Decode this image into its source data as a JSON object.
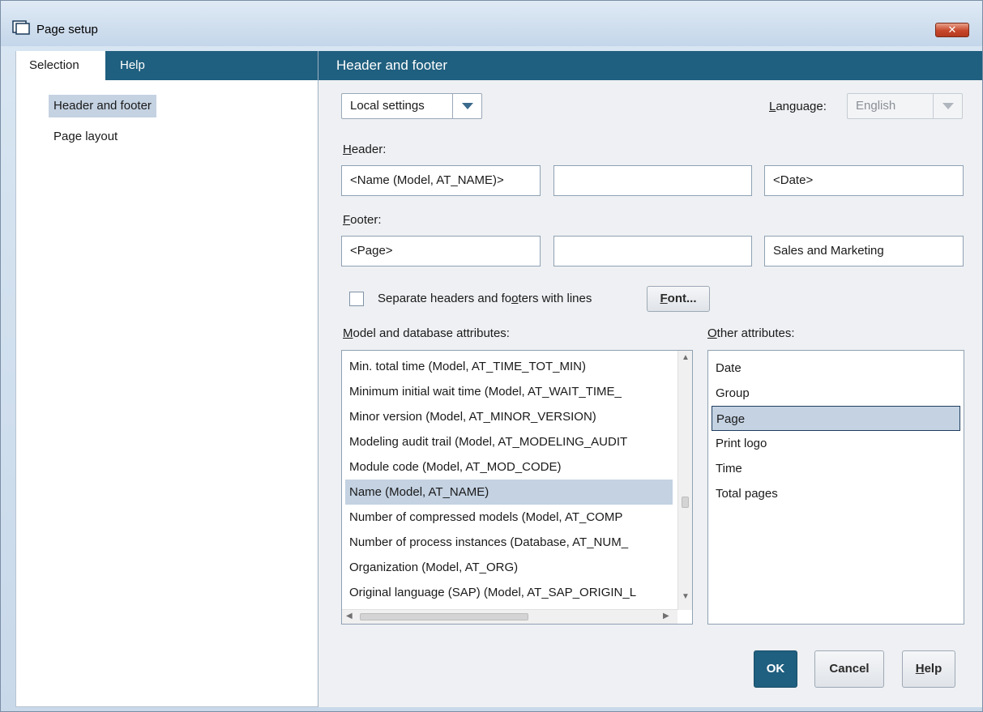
{
  "window": {
    "title": "Page setup",
    "close_label": "✕"
  },
  "left": {
    "tabs": [
      {
        "label": "Selection",
        "active": true
      },
      {
        "label": "Help",
        "active": false
      }
    ],
    "nav": [
      {
        "label": "Header and footer",
        "selected": true
      },
      {
        "label": "Page layout",
        "selected": false
      }
    ]
  },
  "right": {
    "section_title": "Header and footer",
    "settings_combo": "Local settings",
    "language_label_prefix": "",
    "language_label_mnemonic": "L",
    "language_label_rest": "anguage:",
    "language_value": "English",
    "header_label_mnemonic": "H",
    "header_label_rest": "eader:",
    "header_fields": [
      "<Name (Model, AT_NAME)>",
      "",
      "<Date>"
    ],
    "footer_label_mnemonic": "F",
    "footer_label_rest": "ooter:",
    "footer_fields": [
      "<Page>",
      "",
      "Sales and Marketing"
    ],
    "separate_lines_pre": "Separate headers and fo",
    "separate_lines_mnemonic": "o",
    "separate_lines_post": "ters with lines",
    "font_button_mnemonic": "F",
    "font_button_rest": "ont...",
    "model_attr_label_mnemonic": "M",
    "model_attr_label_rest": "odel and database attributes:",
    "model_attributes": [
      "Min. total time (Model, AT_TIME_TOT_MIN)",
      "Minimum initial wait time (Model, AT_WAIT_TIME_",
      "Minor version (Model, AT_MINOR_VERSION)",
      "Modeling audit trail (Model, AT_MODELING_AUDIT",
      "Module code (Model, AT_MOD_CODE)",
      "Name (Model, AT_NAME)",
      "Number of compressed models (Model, AT_COMP",
      "Number of process instances (Database, AT_NUM_",
      "Organization (Model, AT_ORG)",
      "Original language (SAP) (Model, AT_SAP_ORIGIN_L"
    ],
    "model_attributes_selected_index": 5,
    "other_attr_label_mnemonic": "O",
    "other_attr_label_rest": "ther attributes:",
    "other_attributes": [
      "Date",
      "Group",
      "Page",
      "Print logo",
      "Time",
      "Total pages"
    ],
    "other_attributes_selected_index": 2,
    "ok_label": "OK",
    "cancel_label": "Cancel",
    "help_mnemonic": "H",
    "help_rest": "elp"
  },
  "colors": {
    "accent": "#1f5f7f",
    "selection": "#c4d2e2"
  },
  "icons": {
    "window": "page-setup-icon",
    "close": "close-icon",
    "dropdown": "chevron-down-icon"
  }
}
